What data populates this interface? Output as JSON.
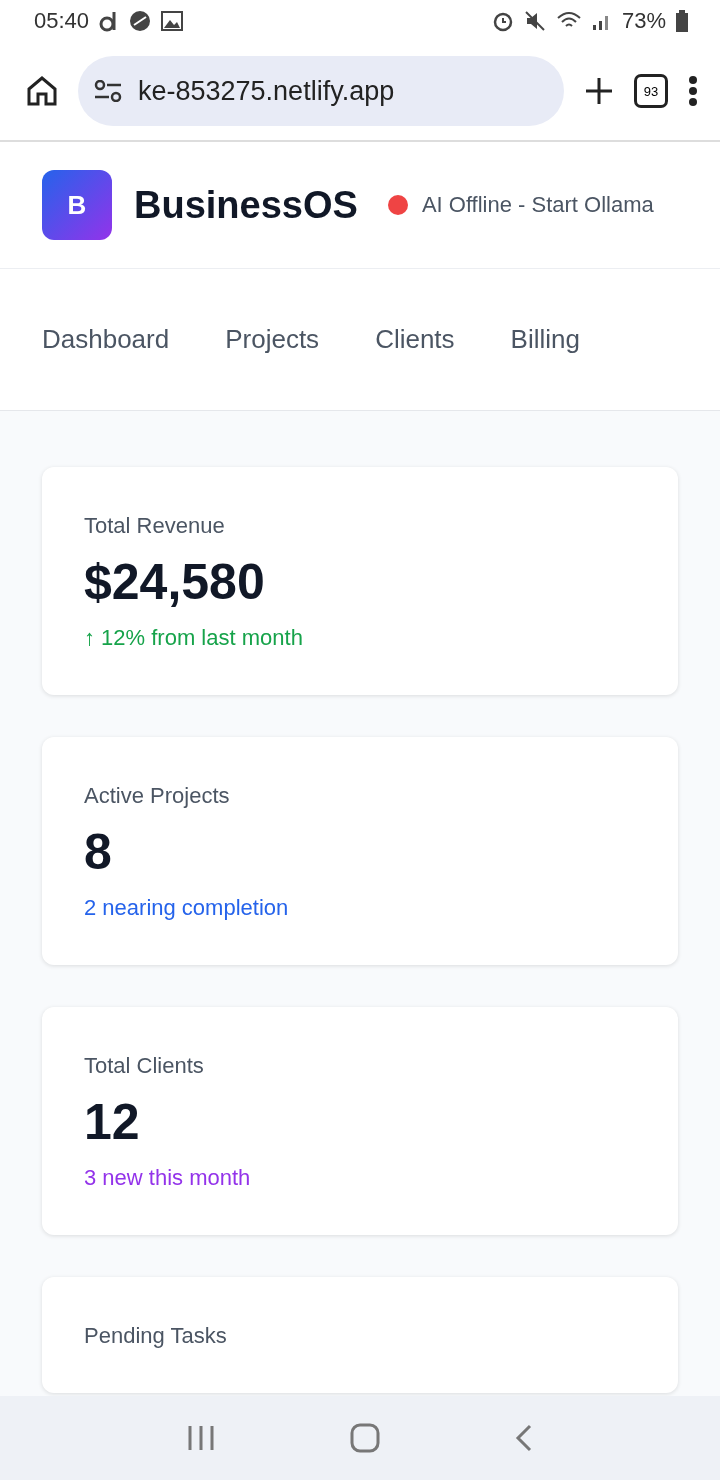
{
  "status_bar": {
    "time": "05:40",
    "battery": "73%"
  },
  "browser": {
    "url": "ke-853275.netlify.app",
    "tab_count": "93"
  },
  "header": {
    "logo_letter": "B",
    "title": "BusinessOS",
    "ai_status": {
      "text": "AI Offline - Start Ollama",
      "color": "#ef4444"
    }
  },
  "tabs": [
    {
      "label": "Dashboard",
      "selected": false
    },
    {
      "label": "Projects",
      "selected": false
    },
    {
      "label": "Clients",
      "selected": false
    },
    {
      "label": "Billing",
      "selected": false
    }
  ],
  "cards": [
    {
      "label": "Total Revenue",
      "value": "$24,580",
      "note": "↑ 12% from last month",
      "color": "#16a34a"
    },
    {
      "label": "Active Projects",
      "value": "8",
      "note": "2 nearing completion",
      "color": "#2563eb"
    },
    {
      "label": "Total Clients",
      "value": "12",
      "note": "3 new this month",
      "color": "#9333ea"
    },
    {
      "label": "Pending Tasks"
    }
  ]
}
